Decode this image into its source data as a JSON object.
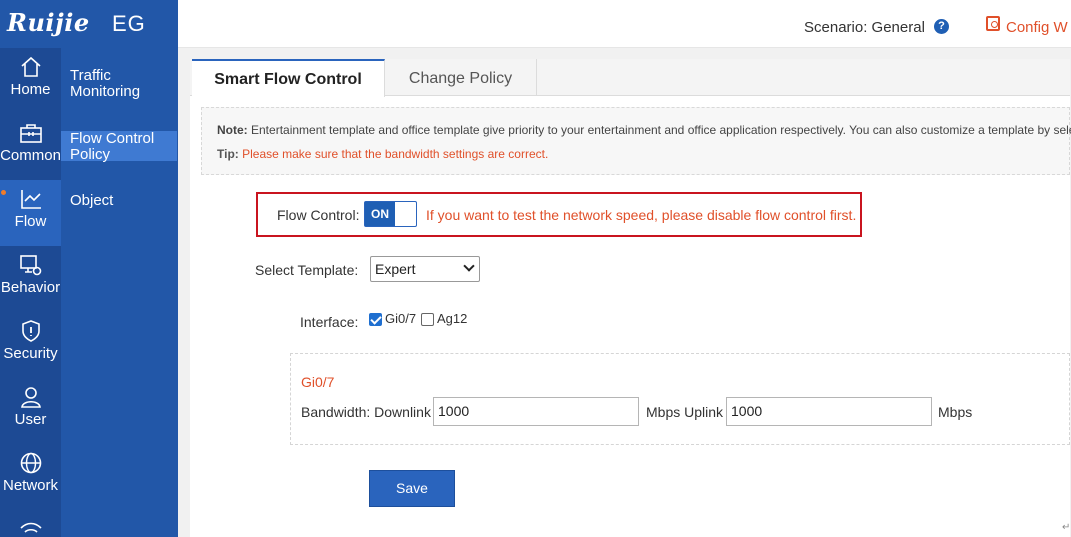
{
  "brand": {
    "logo": "Ruijie",
    "product": "EG"
  },
  "header": {
    "scenario_label": "Scenario:  General",
    "config_link": "Config W"
  },
  "rail": [
    {
      "label": "Home",
      "icon": "home-icon"
    },
    {
      "label": "Common",
      "icon": "toolbox-icon"
    },
    {
      "label": "Flow",
      "icon": "chart-line-icon",
      "active": true
    },
    {
      "label": "Behavior",
      "icon": "monitor-gear-icon"
    },
    {
      "label": "Security",
      "icon": "shield-icon"
    },
    {
      "label": "User",
      "icon": "user-icon"
    },
    {
      "label": "Network",
      "icon": "globe-icon"
    },
    {
      "label": "",
      "icon": "wifi-icon"
    }
  ],
  "submenu": [
    {
      "label": "Traffic Monitoring"
    },
    {
      "label": "Flow Control Policy",
      "active": true
    },
    {
      "label": "Object"
    }
  ],
  "tabs": [
    {
      "label": "Smart Flow Control",
      "active": true
    },
    {
      "label": "Change Policy"
    }
  ],
  "notes": {
    "note_label": "Note:",
    "note_text": " Entertainment template and office template give priority to your entertainment and office application respectively. You can also customize a template by sele",
    "tip_label": "Tip:",
    "tip_text": " Please make sure that the bandwidth settings are correct."
  },
  "flow_control": {
    "label": "Flow Control:",
    "toggle_state": "ON",
    "hint": "If you want to test the network speed, please disable flow control first."
  },
  "template": {
    "label": "Select Template:",
    "selected": "Expert"
  },
  "interface": {
    "label": "Interface:",
    "options": [
      {
        "label": "Gi0/7",
        "checked": true
      },
      {
        "label": "Ag12",
        "checked": false
      }
    ]
  },
  "bandwidth": {
    "title": "Gi0/7",
    "label": "Bandwidth: Downlink",
    "downlink": "1000",
    "mid_label": "Mbps Uplink",
    "uplink": "1000",
    "unit": "Mbps"
  },
  "save_label": "Save",
  "colors": {
    "accent": "#2a64bd",
    "warning": "#e0502a",
    "highlight_border": "#c9141f"
  }
}
